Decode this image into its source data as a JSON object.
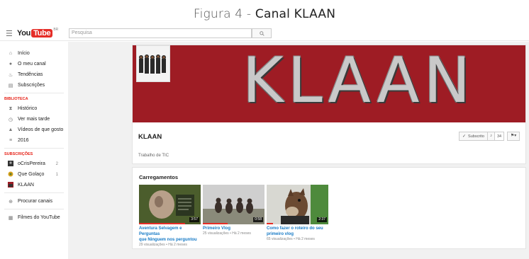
{
  "caption": {
    "prefix": "Figura 4  -  ",
    "title": "Canal KLAAN"
  },
  "header": {
    "menu_icon": "hamburger-icon",
    "logo_you": "You",
    "logo_tube": "Tube",
    "logo_region": "BR",
    "search_placeholder": "Pesquisa",
    "search_icon": "🔍"
  },
  "sidebar": {
    "main_items": [
      {
        "label": "Início",
        "icon": "home-icon",
        "glyph": "⌂"
      },
      {
        "label": "O meu canal",
        "icon": "user-icon",
        "glyph": "●"
      },
      {
        "label": "Tendências",
        "icon": "flame-icon",
        "glyph": "♨"
      },
      {
        "label": "Subscrições",
        "icon": "subscriptions-icon",
        "glyph": "▤"
      }
    ],
    "library_title": "BIBLIOTECA",
    "library_items": [
      {
        "label": "Histórico",
        "icon": "hourglass-icon",
        "glyph": "⧗"
      },
      {
        "label": "Ver mais tarde",
        "icon": "clock-icon",
        "glyph": "◷"
      },
      {
        "label": "Vídeos de que gosto",
        "icon": "thumbs-up-icon",
        "glyph": "▲"
      },
      {
        "label": "2016",
        "icon": "playlist-icon",
        "glyph": "≡"
      }
    ],
    "subscriptions_title": "SUBSCRIÇÕES",
    "subscriptions": [
      {
        "label": "oCrisPereira",
        "count": "2"
      },
      {
        "label": "Que Golaço",
        "count": "1"
      },
      {
        "label": "KLAAN",
        "count": ""
      }
    ],
    "extra_items": [
      {
        "label": "Procurar canais",
        "icon": "plus-circle-icon",
        "glyph": "⊕"
      },
      {
        "label": "Filmes do YouTube",
        "icon": "film-icon",
        "glyph": "▦"
      }
    ]
  },
  "channel": {
    "banner_text": "KLAAN",
    "name": "KLAAN",
    "description": "Trabalho de TIC",
    "subscribe_label": "Subscrito",
    "subscriber_count": "34",
    "colors": {
      "banner": "#9e1c24",
      "link": "#167ac6",
      "accent": "#e62117"
    }
  },
  "uploads": {
    "title": "Carregamentos",
    "videos": [
      {
        "title_lines": [
          "Aventura Selvagem e Perguntas",
          "que Ninguem nos perguntou"
        ],
        "meta": "29 visualizações • Há 2 meses",
        "duration": "3:57",
        "watched_fraction": 0.75
      },
      {
        "title_lines": [
          "Primeiro Vlog",
          ""
        ],
        "meta": "25 visualizações • Há 2 meses",
        "duration": "0:58",
        "watched_fraction": 0.4
      },
      {
        "title_lines": [
          "Como fazer o roteiro do seu",
          "primeiro vlog"
        ],
        "meta": "65 visualizações • Há 2 meses",
        "duration": "2:37",
        "watched_fraction": 0.1
      }
    ]
  }
}
